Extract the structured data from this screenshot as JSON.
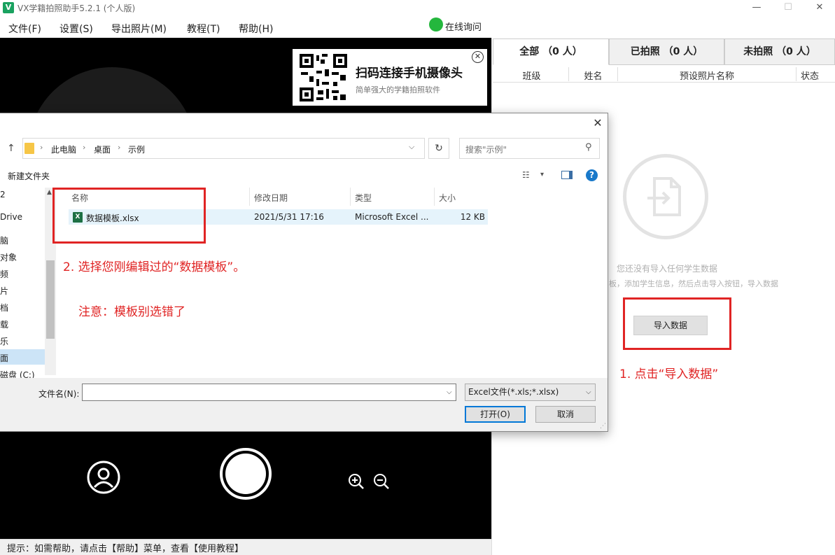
{
  "window": {
    "icon_text": "V",
    "title": "VX学籍拍照助手5.2.1 (个人版)",
    "minimize": "—",
    "maximize": "☐",
    "close": "✕"
  },
  "menu": {
    "items": [
      "文件(F)",
      "设置(S)",
      "导出照片(M)",
      "教程(T)",
      "帮助(H)"
    ],
    "online": "在线询问"
  },
  "qr_card": {
    "title": "扫码连接手机摄像头",
    "subtitle": "简单强大的学籍拍照软件",
    "close": "✕"
  },
  "status_bar": {
    "text": "提示：如需帮助，请点击【帮助】菜单，查看【使用教程】"
  },
  "right_panel": {
    "tabs": [
      "全部 （0 人）",
      "已拍照 （0 人）",
      "未拍照 （0 人）"
    ],
    "columns": [
      "班级",
      "姓名",
      "预设照片名称",
      "状态"
    ],
    "empty_line1": "您还没有导入任何学生数据",
    "empty_line2": "板，添加学生信息，然后点击导入按钮，导入数据",
    "import_button": "导入数据",
    "annotation_step1": "1.  点击“导入数据”"
  },
  "dialog": {
    "close": "✕",
    "breadcrumb": [
      "此电脑",
      "桌面",
      "示例"
    ],
    "search_placeholder": "搜索\"示例\"",
    "new_folder": "新建文件夹",
    "nav_items": [
      "2",
      "Drive",
      "脑",
      "对象",
      "频",
      "片",
      "档",
      "载",
      "乐",
      "面",
      "磁盘 (C:)"
    ],
    "columns": [
      "名称",
      "修改日期",
      "类型",
      "大小"
    ],
    "files": [
      {
        "name": "数据模板.xlsx",
        "modified": "2021/5/31 17:16",
        "type": "Microsoft Excel ...",
        "size": "12 KB"
      }
    ],
    "annotation_step2": "2. 选择您刚编辑过的“数据模板”。",
    "annotation_note": "注意：模板别选错了",
    "filename_label": "文件名(N):",
    "filename_value": "",
    "filter": "Excel文件(*.xls;*.xlsx)",
    "open_button": "打开(O)",
    "cancel_button": "取消"
  },
  "colors": {
    "annotation_red": "#e02424",
    "wechat_green": "#24b73d",
    "selection_blue": "#e5f3fb"
  }
}
